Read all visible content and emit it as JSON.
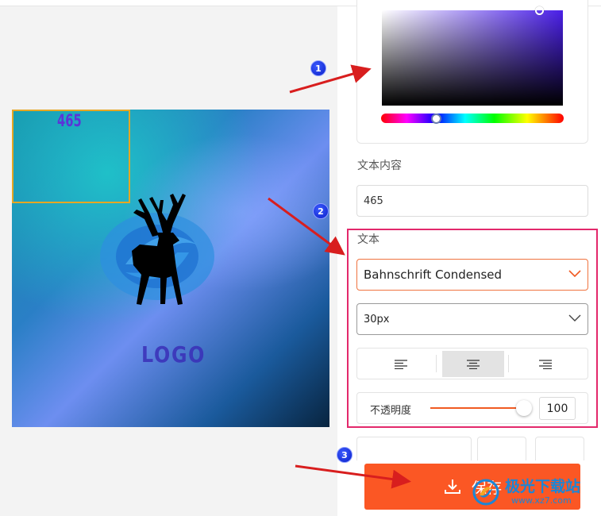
{
  "canvas": {
    "overlay_text": "465",
    "logo_text": "LOGO"
  },
  "panel": {
    "text_content_label": "文本内容",
    "text_content_value": "465",
    "text_section_label": "文本",
    "font_family": "Bahnschrift Condensed",
    "font_size": "30px",
    "opacity_label": "不透明度",
    "opacity_value": "100",
    "save_label": "保存",
    "color_picker": {
      "hue_color": "#4a1fe8"
    }
  },
  "annotations": {
    "badges": [
      "1",
      "2",
      "3"
    ]
  },
  "watermark": {
    "title": "极光下载站",
    "url": "www.xz7.com"
  },
  "colors": {
    "accent": "#fb5724",
    "highlight_border": "#e3286b",
    "arrow": "#d81e1e",
    "badge": "#1a2fd8"
  }
}
